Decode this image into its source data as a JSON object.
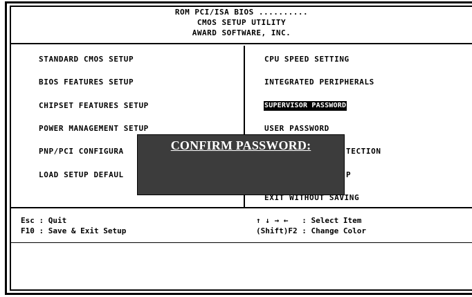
{
  "header": {
    "line1": "ROM PCI/ISA BIOS ..........",
    "line2": "CMOS SETUP UTILITY",
    "line3": "AWARD SOFTWARE, INC."
  },
  "menu": {
    "left": [
      "STANDARD CMOS SETUP",
      "BIOS FEATURES SETUP",
      "CHIPSET FEATURES SETUP",
      "POWER MANAGEMENT SETUP",
      "PNP/PCI CONFIGURA",
      "LOAD SETUP DEFAUL"
    ],
    "right": [
      "CPU SPEED SETTING",
      "INTEGRATED PERIPHERALS",
      "SUPERVISOR PASSWORD",
      "USER PASSWORD",
      "TECTION",
      "P",
      "EXIT WITHOUT SAVING"
    ]
  },
  "footer": {
    "left_line1": "Esc : Quit",
    "left_line2": "F10 : Save & Exit Setup",
    "right_line1": "↑ ↓ → ←   : Select Item",
    "right_line2": "(Shift)F2 : Change Color"
  },
  "dialog": {
    "title": "CONFIRM PASSWORD:"
  }
}
